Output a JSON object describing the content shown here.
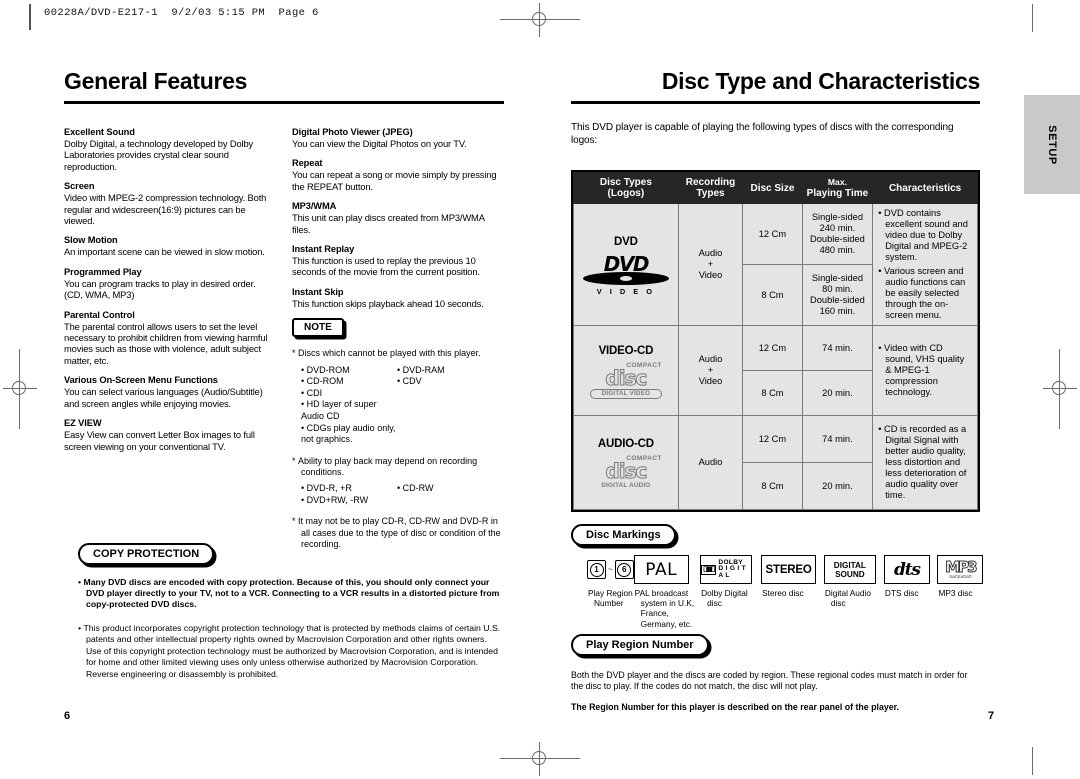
{
  "slug": "00228A/DVD-E217-1  9/2/03 5:15 PM  Page 6",
  "left_page": {
    "title": "General Features",
    "page_number": "6",
    "column1": [
      {
        "heading": "Excellent Sound",
        "body": "Dolby Digital, a technology developed by Dolby Laboratories provides crystal clear sound reproduction."
      },
      {
        "heading": "Screen",
        "body": "Video with MPEG-2 compression technology. Both regular and widescreen(16:9) pictures can be viewed."
      },
      {
        "heading": "Slow Motion",
        "body": "An important scene can be viewed in slow motion."
      },
      {
        "heading": "Programmed Play",
        "body": "You can program tracks to play in desired order. (CD, WMA, MP3)"
      },
      {
        "heading": "Parental Control",
        "body": "The parental control allows users to set the level necessary to prohibit children from viewing harmful movies such as those with violence, adult subject matter, etc."
      },
      {
        "heading": "Various On-Screen Menu Functions",
        "body": "You can select various languages (Audio/Subtitle) and screen angles while enjoying movies."
      },
      {
        "heading": "EZ VIEW",
        "body": "Easy View can convert Letter Box images to full screen viewing on your conventional TV."
      }
    ],
    "column2": [
      {
        "heading": "Digital Photo Viewer (JPEG)",
        "body": "You can view the Digital Photos on your TV."
      },
      {
        "heading": "Repeat",
        "body": "You can repeat a song or movie simply by pressing the REPEAT button."
      },
      {
        "heading": "MP3/WMA",
        "body": "This unit can play discs created from MP3/WMA files."
      },
      {
        "heading": "Instant Replay",
        "body": "This function is used to replay the previous 10 seconds of the movie from the current position."
      },
      {
        "heading": "Instant Skip",
        "body": "This function skips playback ahead 10 seconds."
      }
    ],
    "note": {
      "label": "NOTE",
      "item1": "Discs which cannot be played with this player.",
      "list1_left": [
        "DVD-ROM",
        "CD-ROM",
        "CDI",
        "HD layer of super Audio CD",
        "CDGs play audio only, not graphics."
      ],
      "list1_right": [
        "DVD-RAM",
        "CDV"
      ],
      "item2": "Ability to play back may depend on recording conditions.",
      "list2_left": [
        "DVD-R, +R",
        "DVD+RW, -RW"
      ],
      "list2_right": [
        "CD-RW"
      ],
      "item3": "It may not be to play CD-R, CD-RW and DVD-R in all cases due to the type of disc or condition of the recording."
    },
    "copy_protection": {
      "label": "COPY PROTECTION",
      "bullet_bold": "Many DVD discs are encoded with copy protection. Because of this, you should only connect your DVD player directly to your TV, not to a VCR. Connecting to a VCR results in a distorted picture from copy-protected DVD discs.",
      "bullet_plain": "This product incorporates copyright protection technology that is protected by methods claims of certain U.S. patents and other intellectual property rights owned by Macrovision Corporation and other rights owners. Use of this copyright protection technology must be authorized by Macrovision Corporation, and is intended for home and other limited viewing uses only unless otherwise authorized by Macrovision Corporation. Reverse engineering or disassembly is prohibited."
    }
  },
  "right_page": {
    "title": "Disc Type and Characteristics",
    "page_number": "7",
    "intro": "This DVD player is capable of playing the following types of discs with the corresponding logos:",
    "tab_label": "SETUP",
    "table": {
      "headers": [
        "Disc Types (Logos)",
        "Recording Types",
        "Disc Size",
        "Max. Playing Time",
        "Characteristics"
      ],
      "headers_split": [
        {
          "l1": "Disc Types",
          "l2": "(Logos)"
        },
        {
          "l1": "Recording",
          "l2": "Types"
        },
        {
          "l1": "Disc Size",
          "l2": ""
        },
        {
          "l1": "Max.",
          "l2": "Playing Time"
        },
        {
          "l1": "Characteristics",
          "l2": ""
        }
      ],
      "rows": [
        {
          "type": "DVD",
          "logo": "dvd-video-logo",
          "logo_sub": "V I D E O",
          "recording": "Audio + Video",
          "recording_l1": "Audio",
          "recording_l2": "+",
          "recording_l3": "Video",
          "sizes": [
            {
              "size": "12 Cm",
              "time": "Single-sided 240 min. Double-sided 480 min.",
              "time_lines": [
                "Single-sided",
                "240 min.",
                "Double-sided",
                "480 min."
              ]
            },
            {
              "size": "8 Cm",
              "time": "Single-sided 80 min. Double-sided 160 min.",
              "time_lines": [
                "Single-sided",
                "80 min.",
                "Double-sided",
                "160 min."
              ]
            }
          ],
          "characteristics": [
            "DVD contains excellent sound and video due to Dolby Digital and MPEG-2 system.",
            "Various screen and audio functions can be easily selected through the on-screen menu."
          ]
        },
        {
          "type": "VIDEO-CD",
          "logo": "compact-disc-digital-video-logo",
          "logo_top": "COMPACT",
          "logo_bottom": "DIGITAL VIDEO",
          "recording": "Audio + Video",
          "recording_l1": "Audio",
          "recording_l2": "+",
          "recording_l3": "Video",
          "sizes": [
            {
              "size": "12 Cm",
              "time": "74 min.",
              "time_lines": [
                "74 min."
              ]
            },
            {
              "size": "8 Cm",
              "time": "20 min.",
              "time_lines": [
                "20 min."
              ]
            }
          ],
          "characteristics": [
            "Video with CD sound, VHS quality & MPEG-1 compression technology."
          ]
        },
        {
          "type": "AUDIO-CD",
          "logo": "compact-disc-digital-audio-logo",
          "logo_top": "COMPACT",
          "logo_bottom": "DIGITAL AUDIO",
          "recording": "Audio",
          "recording_l1": "Audio",
          "recording_l2": "",
          "recording_l3": "",
          "sizes": [
            {
              "size": "12 Cm",
              "time": "74 min.",
              "time_lines": [
                "74 min."
              ]
            },
            {
              "size": "8 Cm",
              "time": "20 min.",
              "time_lines": [
                "20 min."
              ]
            }
          ],
          "characteristics": [
            "CD is recorded as a Digital Signal with better audio quality, less distortion and less deterioration of audio quality over time."
          ]
        }
      ]
    },
    "disc_markings": {
      "label": "Disc Markings",
      "items": [
        {
          "logo": "play-region-number-logo",
          "region_from": "1",
          "region_to": "6",
          "tilde": "~",
          "caption": "Play Region Number"
        },
        {
          "logo": "pal-logo",
          "text": "PAL",
          "caption": "PAL broadcast system in U.K, France, Germany, etc."
        },
        {
          "logo": "dolby-digital-logo",
          "text_l1": "DOLBY",
          "text_l2": "D I G I T A L",
          "caption": "Dolby Digital disc"
        },
        {
          "logo": "stereo-logo",
          "text": "STEREO",
          "caption": "Stereo disc"
        },
        {
          "logo": "digital-sound-logo",
          "text_l1": "DIGITAL",
          "text_l2": "SOUND",
          "caption": "Digital Audio disc"
        },
        {
          "logo": "dts-logo",
          "text": "dts",
          "caption": "DTS disc"
        },
        {
          "logo": "mp3-logo",
          "text": "MP3",
          "text_sub": "SaCKaGeD",
          "caption": "MP3 disc"
        }
      ]
    },
    "play_region": {
      "label": "Play Region Number",
      "body": "Both the DVD player and the discs are coded by region. These regional codes must match in order for the disc to play. If the codes do not match, the disc will not play.",
      "bold": "The Region Number for this player is described on the rear panel of the player."
    }
  }
}
